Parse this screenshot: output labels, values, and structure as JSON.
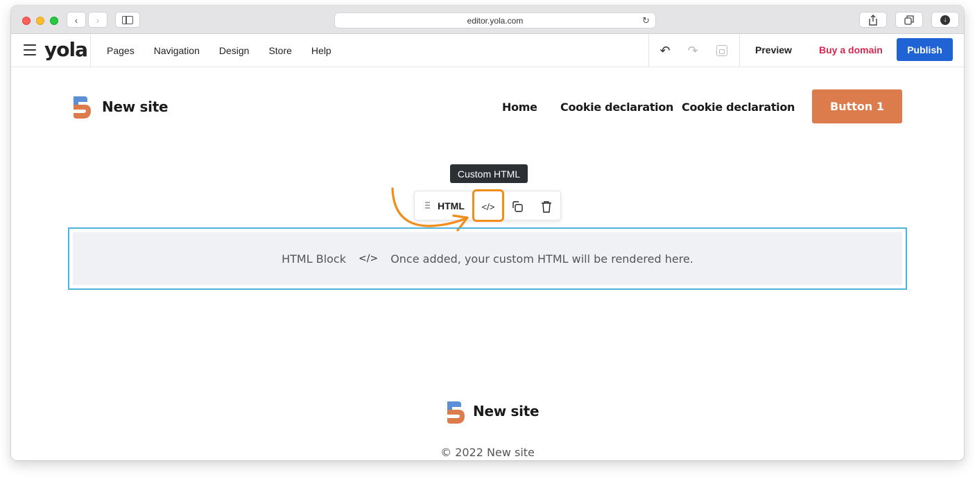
{
  "browser": {
    "url": "editor.yola.com"
  },
  "editor": {
    "logo": "yola",
    "menu": [
      "Pages",
      "Navigation",
      "Design",
      "Store",
      "Help"
    ],
    "preview_label": "Preview",
    "buy_domain_label": "Buy a domain",
    "publish_label": "Publish",
    "colors": {
      "publish": "#1f63d4",
      "buy_domain": "#d7264e"
    }
  },
  "site": {
    "title": "New site",
    "nav": [
      "Home",
      "Cookie declaration",
      "Cookie declaration"
    ],
    "button_label": "Button 1",
    "colors": {
      "button": "#dc7c4c",
      "logo_top": "#5b8fd6",
      "logo_bottom": "#dc7c4c"
    }
  },
  "block_toolbar": {
    "tooltip": "Custom HTML",
    "type_label": "HTML",
    "code_glyph": "</>",
    "highlight_color": "#f28c1a"
  },
  "html_block": {
    "label": "HTML Block",
    "glyph": "</>",
    "message": "Once added, your custom HTML will be rendered here.",
    "border_color": "#4fb3d9"
  },
  "footer": {
    "title": "New site",
    "copyright": "© 2022 New site"
  }
}
